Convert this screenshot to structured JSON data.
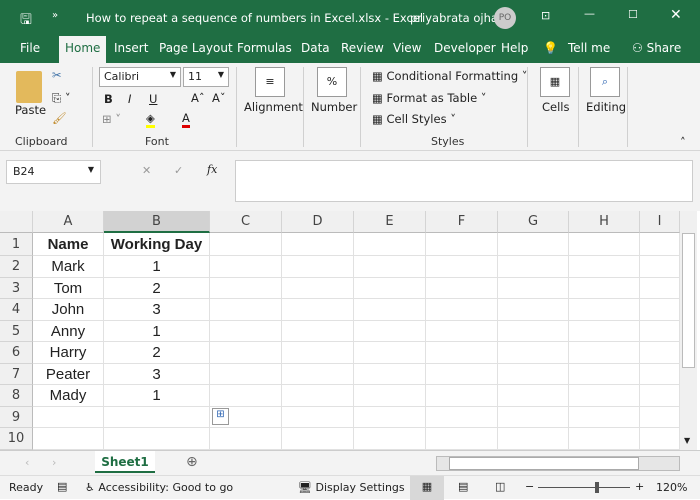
{
  "window": {
    "title": "How to repeat a sequence of numbers in Excel.xlsx  -  Excel",
    "user": "priyabrata ojha",
    "avatar": "PO"
  },
  "tabs": [
    "File",
    "Home",
    "Insert",
    "Page Layout",
    "Formulas",
    "Data",
    "Review",
    "View",
    "Developer",
    "Help",
    "Tell me",
    "Share"
  ],
  "ribbon": {
    "paste": "Paste",
    "clipboard": "Clipboard",
    "font_name": "Calibri",
    "font_size": "11",
    "font": "Font",
    "alignment": "Alignment",
    "number": "Number",
    "cond_format": "Conditional Formatting",
    "format_table": "Format as Table",
    "cell_styles": "Cell Styles",
    "styles": "Styles",
    "cells": "Cells",
    "editing": "Editing",
    "bold": "B",
    "italic": "I",
    "underline": "U",
    "fx": "fx"
  },
  "formula_bar": {
    "name_box": "B24",
    "value": ""
  },
  "columns": [
    "A",
    "B",
    "C",
    "D",
    "E",
    "F",
    "G",
    "H",
    "I"
  ],
  "rows": [
    "1",
    "2",
    "3",
    "4",
    "5",
    "6",
    "7",
    "8",
    "9",
    "10"
  ],
  "table": {
    "headers": [
      "Name",
      "Working Day"
    ],
    "data": [
      [
        "Mark",
        "1"
      ],
      [
        "Tom",
        "2"
      ],
      [
        "John",
        "3"
      ],
      [
        "Anny",
        "1"
      ],
      [
        "Harry",
        "2"
      ],
      [
        "Peater",
        "3"
      ],
      [
        "Mady",
        "1"
      ]
    ]
  },
  "sheet_tab": "Sheet1",
  "status": {
    "ready": "Ready",
    "accessibility": "Accessibility: Good to go",
    "display": "Display Settings",
    "zoom": "120%",
    "zoom_level": 120
  },
  "colors": {
    "brand": "#1f6e43"
  }
}
